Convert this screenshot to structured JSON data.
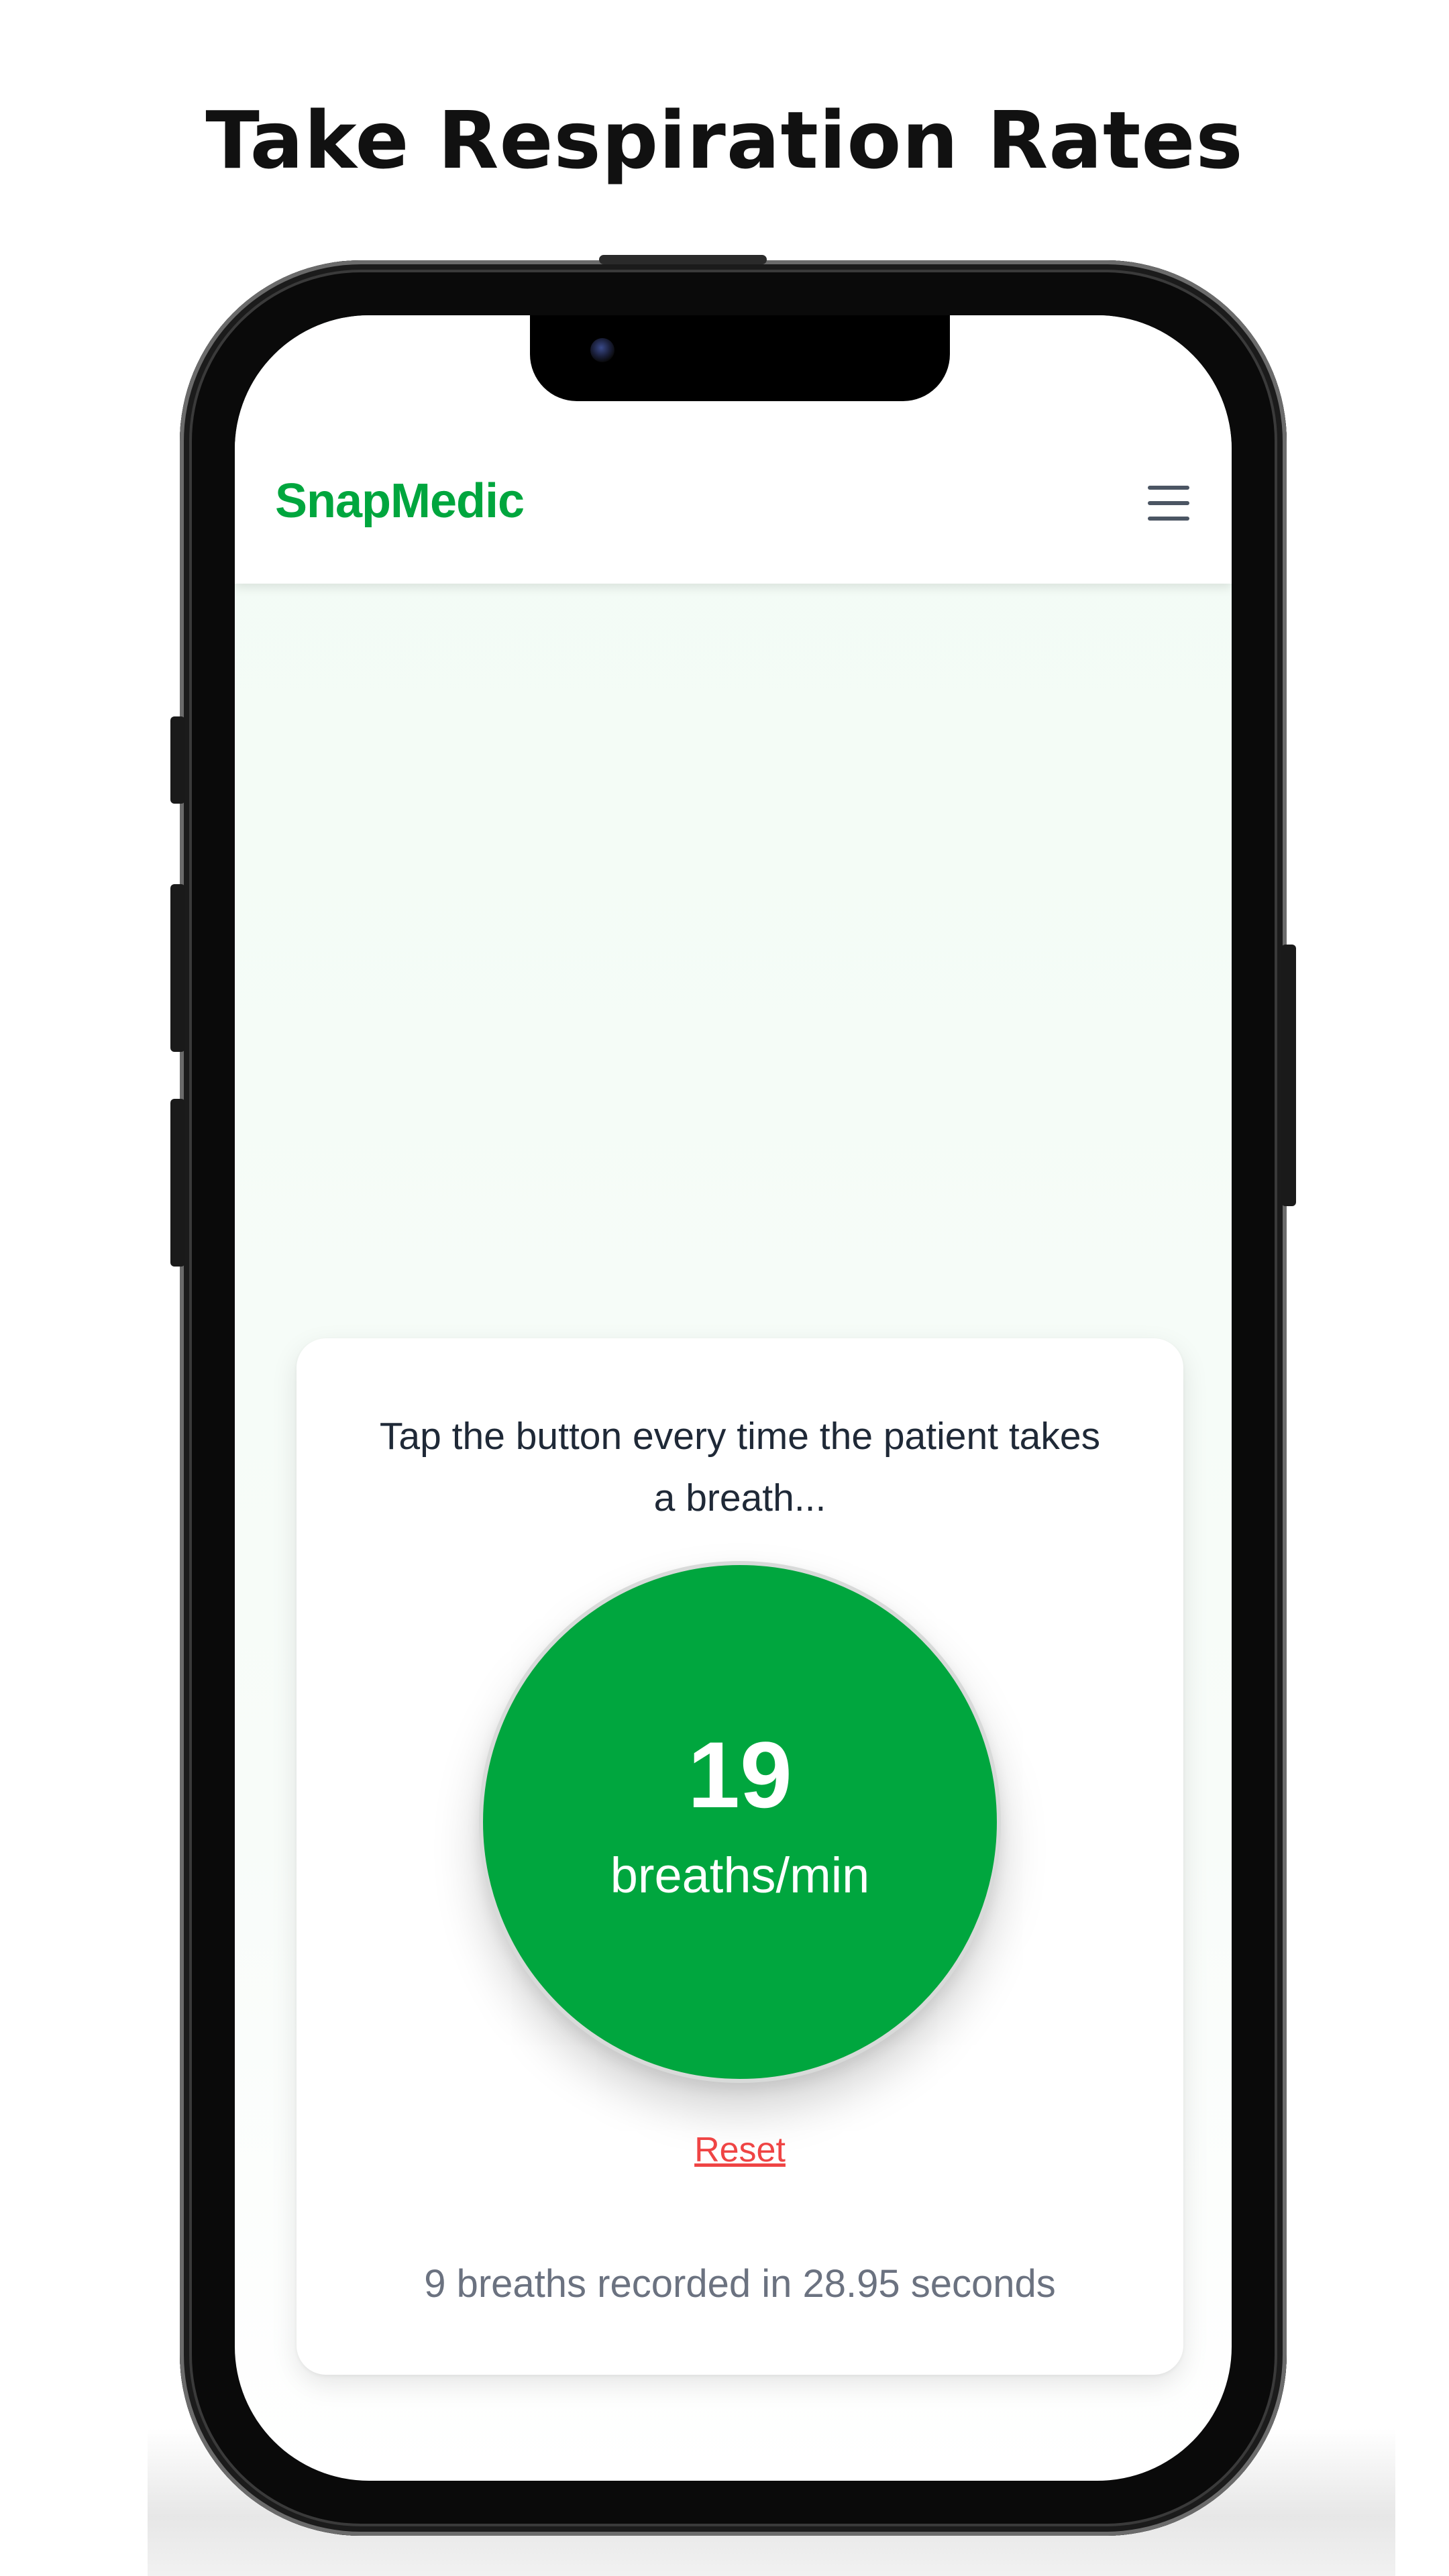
{
  "promo": {
    "title": "Take Respiration Rates"
  },
  "app": {
    "brand": "SnapMedic",
    "menu_icon": "hamburger-menu-icon"
  },
  "card": {
    "instruction": "Tap the button every time the patient takes a breath...",
    "rate_value": "19",
    "rate_unit": "breaths/min",
    "reset_label": "Reset",
    "summary": "9 breaths recorded in 28.95 seconds"
  },
  "colors": {
    "brand_green": "#00a63e",
    "reset_red": "#ef4444",
    "text_dark": "#1f2937",
    "text_muted": "#6b7280"
  }
}
